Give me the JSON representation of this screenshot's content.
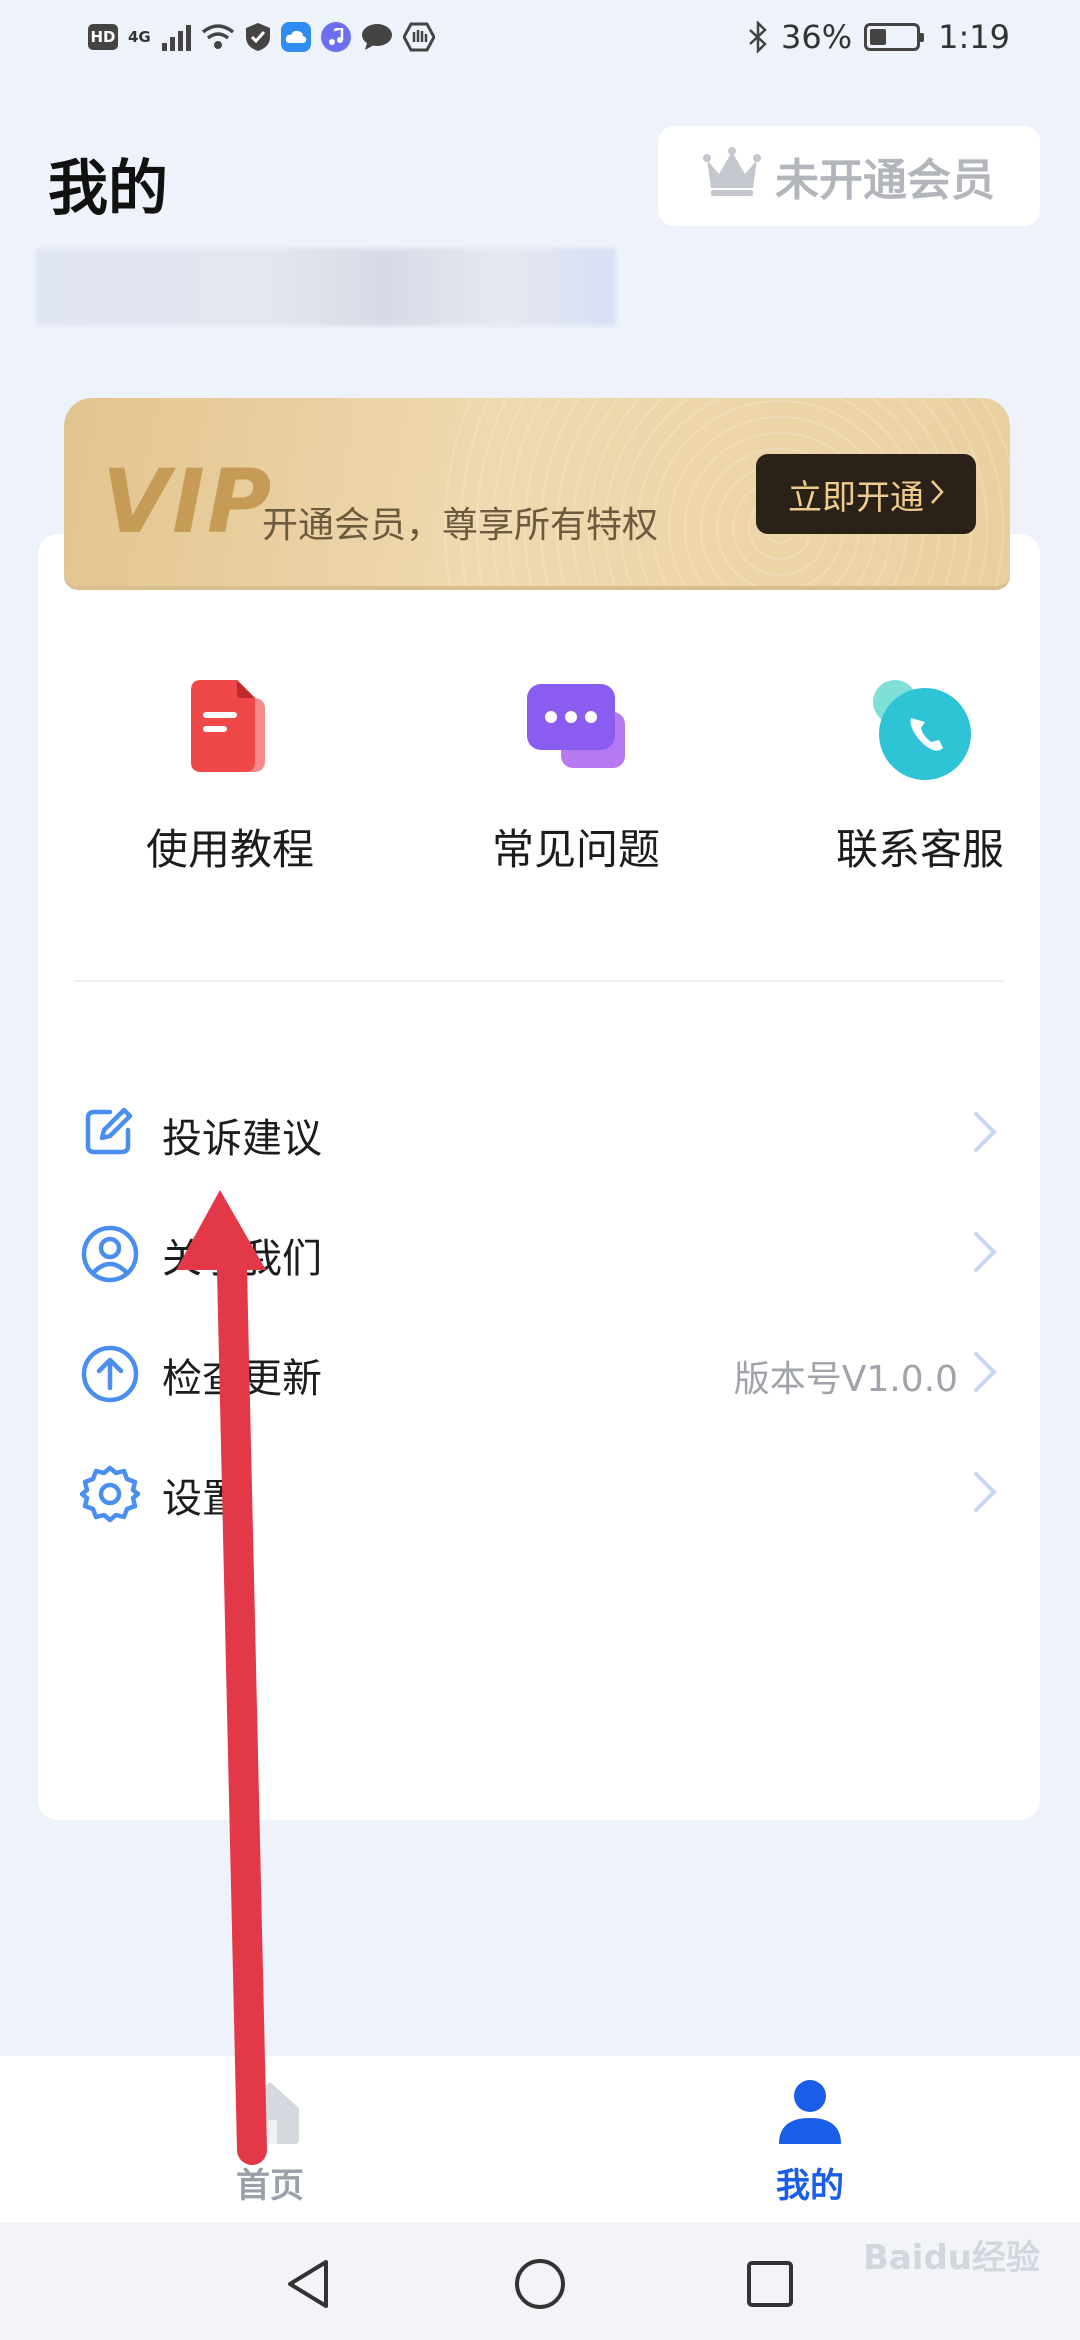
{
  "status_bar": {
    "hd": "HD",
    "network": "4G",
    "battery_percent": "36%",
    "battery_level": 0.36,
    "time": "1:19"
  },
  "header": {
    "title": "我的",
    "member_status": "未开通会员"
  },
  "vip_banner": {
    "logo": "VIP",
    "text": "开通会员，尊享所有特权",
    "button_label": "立即开通"
  },
  "quick_actions": [
    {
      "label": "使用教程",
      "icon": "document-icon",
      "color": "#f04848"
    },
    {
      "label": "常见问题",
      "icon": "chat-bubbles-icon",
      "color": "#8a5cf0"
    },
    {
      "label": "联系客服",
      "icon": "phone-icon",
      "color": "#2fc3d6"
    }
  ],
  "menu": [
    {
      "label": "投诉建议",
      "icon": "edit-icon",
      "value": ""
    },
    {
      "label": "关于我们",
      "icon": "user-circle-icon",
      "value": ""
    },
    {
      "label": "检查更新",
      "icon": "upload-arrow-icon",
      "value": "版本号V1.0.0"
    },
    {
      "label": "设置",
      "icon": "gear-icon",
      "value": ""
    }
  ],
  "bottom_nav": {
    "home_label": "首页",
    "mine_label": "我的",
    "active": "我的",
    "active_color": "#1a5ee8"
  },
  "watermark": "Baidu经验"
}
